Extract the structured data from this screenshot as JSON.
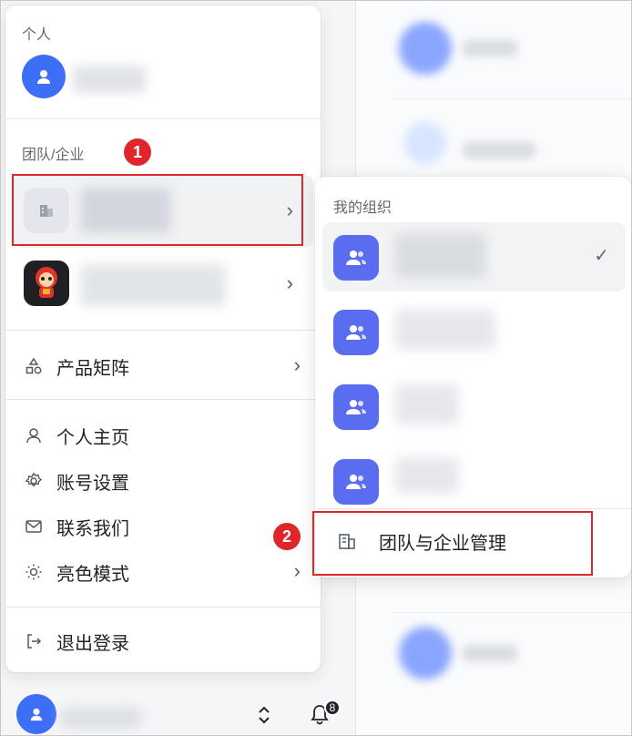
{
  "menu": {
    "personal_section": "个人",
    "team_section": "团队/企业",
    "items": [
      {
        "label": "产品矩阵",
        "icon": "shapes-icon"
      },
      {
        "label": "个人主页",
        "icon": "user-icon"
      },
      {
        "label": "账号设置",
        "icon": "gear-icon"
      },
      {
        "label": "联系我们",
        "icon": "mail-icon"
      },
      {
        "label": "亮色模式",
        "icon": "sun-icon"
      },
      {
        "label": "退出登录",
        "icon": "logout-icon"
      }
    ]
  },
  "org_panel": {
    "title": "我的组织",
    "manage_label": "团队与企业管理"
  },
  "annotations": {
    "step1": "1",
    "step2": "2"
  },
  "bottom": {
    "notification_count": "8"
  },
  "colors": {
    "accent_blue": "#3c6ef6",
    "org_avatar": "#5a6cf0",
    "highlight_red": "#e0262b"
  }
}
